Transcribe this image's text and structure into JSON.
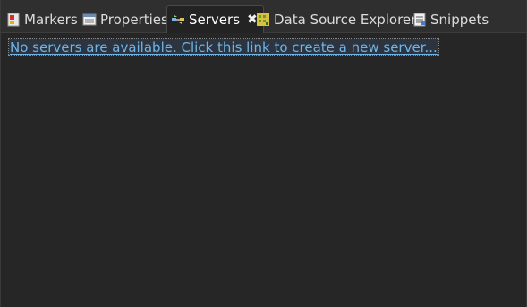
{
  "tabs": [
    {
      "label": "Markers",
      "icon": "markers-icon",
      "active": false
    },
    {
      "label": "Properties",
      "icon": "properties-icon",
      "active": false
    },
    {
      "label": "Servers",
      "icon": "servers-icon",
      "active": true,
      "closable": true
    },
    {
      "label": "Data Source Explorer",
      "icon": "data-source-explorer-icon",
      "active": false
    },
    {
      "label": "Snippets",
      "icon": "snippets-icon",
      "active": false
    }
  ],
  "servers_view": {
    "empty_link": "No servers are available. Click this link to create a new server..."
  },
  "colors": {
    "background": "#262626",
    "tabbar": "#2f2f2f",
    "link": "#6fb4e6"
  }
}
